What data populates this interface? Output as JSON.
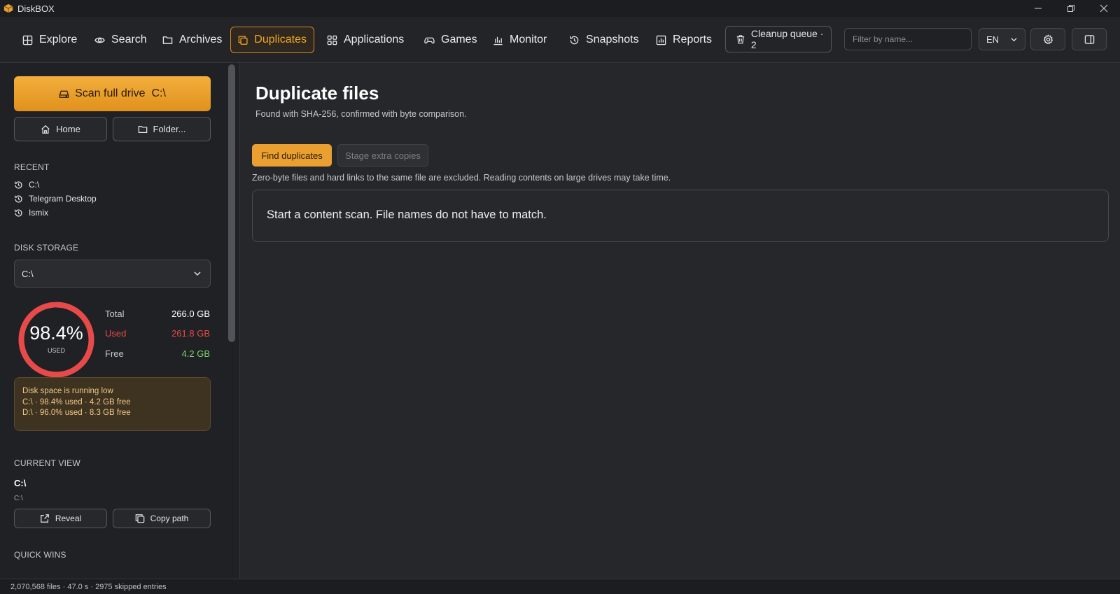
{
  "window": {
    "title": "DiskBOX",
    "app_icon": "box-icon"
  },
  "nav": {
    "items": [
      {
        "label": "Explore",
        "icon": "grid-icon"
      },
      {
        "label": "Search",
        "icon": "eye-icon"
      },
      {
        "label": "Archives",
        "icon": "folder-icon"
      },
      {
        "label": "Duplicates",
        "icon": "copy-icon",
        "active": true
      },
      {
        "label": "Applications",
        "icon": "apps-icon"
      },
      {
        "label": "Games",
        "icon": "gamepad-icon"
      },
      {
        "label": "Monitor",
        "icon": "bar-chart-icon"
      },
      {
        "label": "Snapshots",
        "icon": "history-icon"
      },
      {
        "label": "Reports",
        "icon": "report-icon"
      }
    ],
    "cleanup_label": "Cleanup queue · 2",
    "filter_placeholder": "Filter by name...",
    "filter_value": "",
    "language": "EN"
  },
  "sidebar": {
    "scan_label": "Scan full drive  C:\\",
    "home_label": "Home",
    "folder_label": "Folder...",
    "recent_title": "RECENT",
    "recent": [
      "C:\\",
      "Telegram Desktop",
      "Ismix"
    ],
    "disk_title": "DISK STORAGE",
    "drive_selected": "C:\\",
    "gauge_percent": "98.4%",
    "gauge_fraction": 0.984,
    "gauge_caption": "USED",
    "stats": {
      "total_label": "Total",
      "total_value": "266.0 GB",
      "used_label": "Used",
      "used_value": "261.8 GB",
      "free_label": "Free",
      "free_value": "4.2 GB"
    },
    "warning": {
      "title": "Disk space is running low",
      "line1": "C:\\ · 98.4% used · 4.2 GB free",
      "line2": "D:\\ · 96.0% used · 8.3 GB free"
    },
    "current_view_title": "CURRENT VIEW",
    "current_path": "C:\\",
    "current_sub": "C:\\",
    "reveal_label": "Reveal",
    "copy_path_label": "Copy path",
    "quick_wins_title": "QUICK WINS"
  },
  "main": {
    "title": "Duplicate files",
    "subtitle": "Found with SHA-256, confirmed with byte comparison.",
    "find_label": "Find duplicates",
    "stage_label": "Stage extra copies",
    "note": "Zero-byte files and hard links to the same file are excluded. Reading contents on large drives may take time.",
    "empty_message": "Start a content scan. File names do not have to match."
  },
  "status": {
    "text": "2,070,568 files · 47.0 s · 2975 skipped entries"
  },
  "colors": {
    "accent": "#e9a030",
    "used": "#e84a4a",
    "free": "#7dd36b",
    "warning_bg": "#3e3221"
  }
}
